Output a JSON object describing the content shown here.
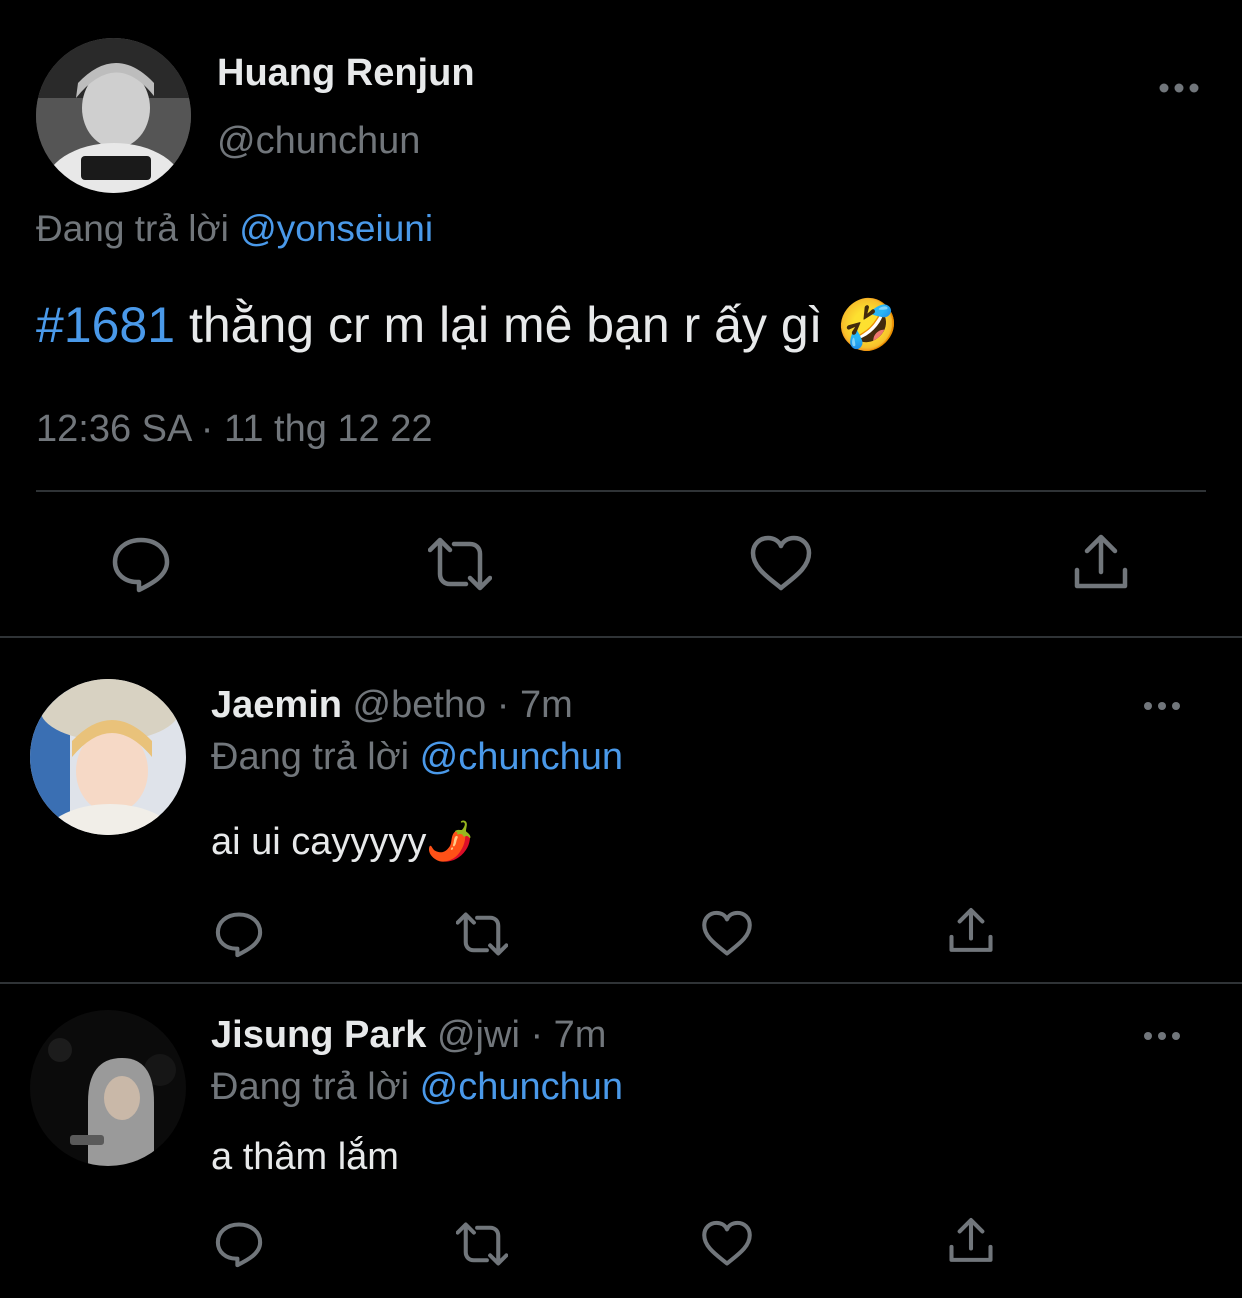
{
  "main_tweet": {
    "author_name": "Huang Renjun",
    "author_handle": "@chunchun",
    "replying_label": "Đang trả lời",
    "replying_to": "@yonseiuni",
    "hashtag": "#1681",
    "text": " thằng cr m lại mê bạn r ấy gì 🤣",
    "timestamp": "12:36 SA · 11 thg 12 22",
    "actions": [
      "reply-icon",
      "retweet-icon",
      "like-icon",
      "share-icon"
    ]
  },
  "replies": [
    {
      "author_name": "Jaemin",
      "meta": " @betho · 7m",
      "replying_label": "Đang trả lời",
      "replying_to": "@chunchun",
      "text": "ai ui cayyyyy🌶️"
    },
    {
      "author_name": "Jisung Park",
      "meta": " @jwi · 7m",
      "replying_label": "Đang trả lời",
      "replying_to": "@chunchun",
      "text": "a thâm lắm"
    }
  ],
  "colors": {
    "background": "#000000",
    "text_primary": "#e7e9ea",
    "text_secondary": "#71767b",
    "accent": "#4a99e9",
    "divider": "#2f3336"
  }
}
